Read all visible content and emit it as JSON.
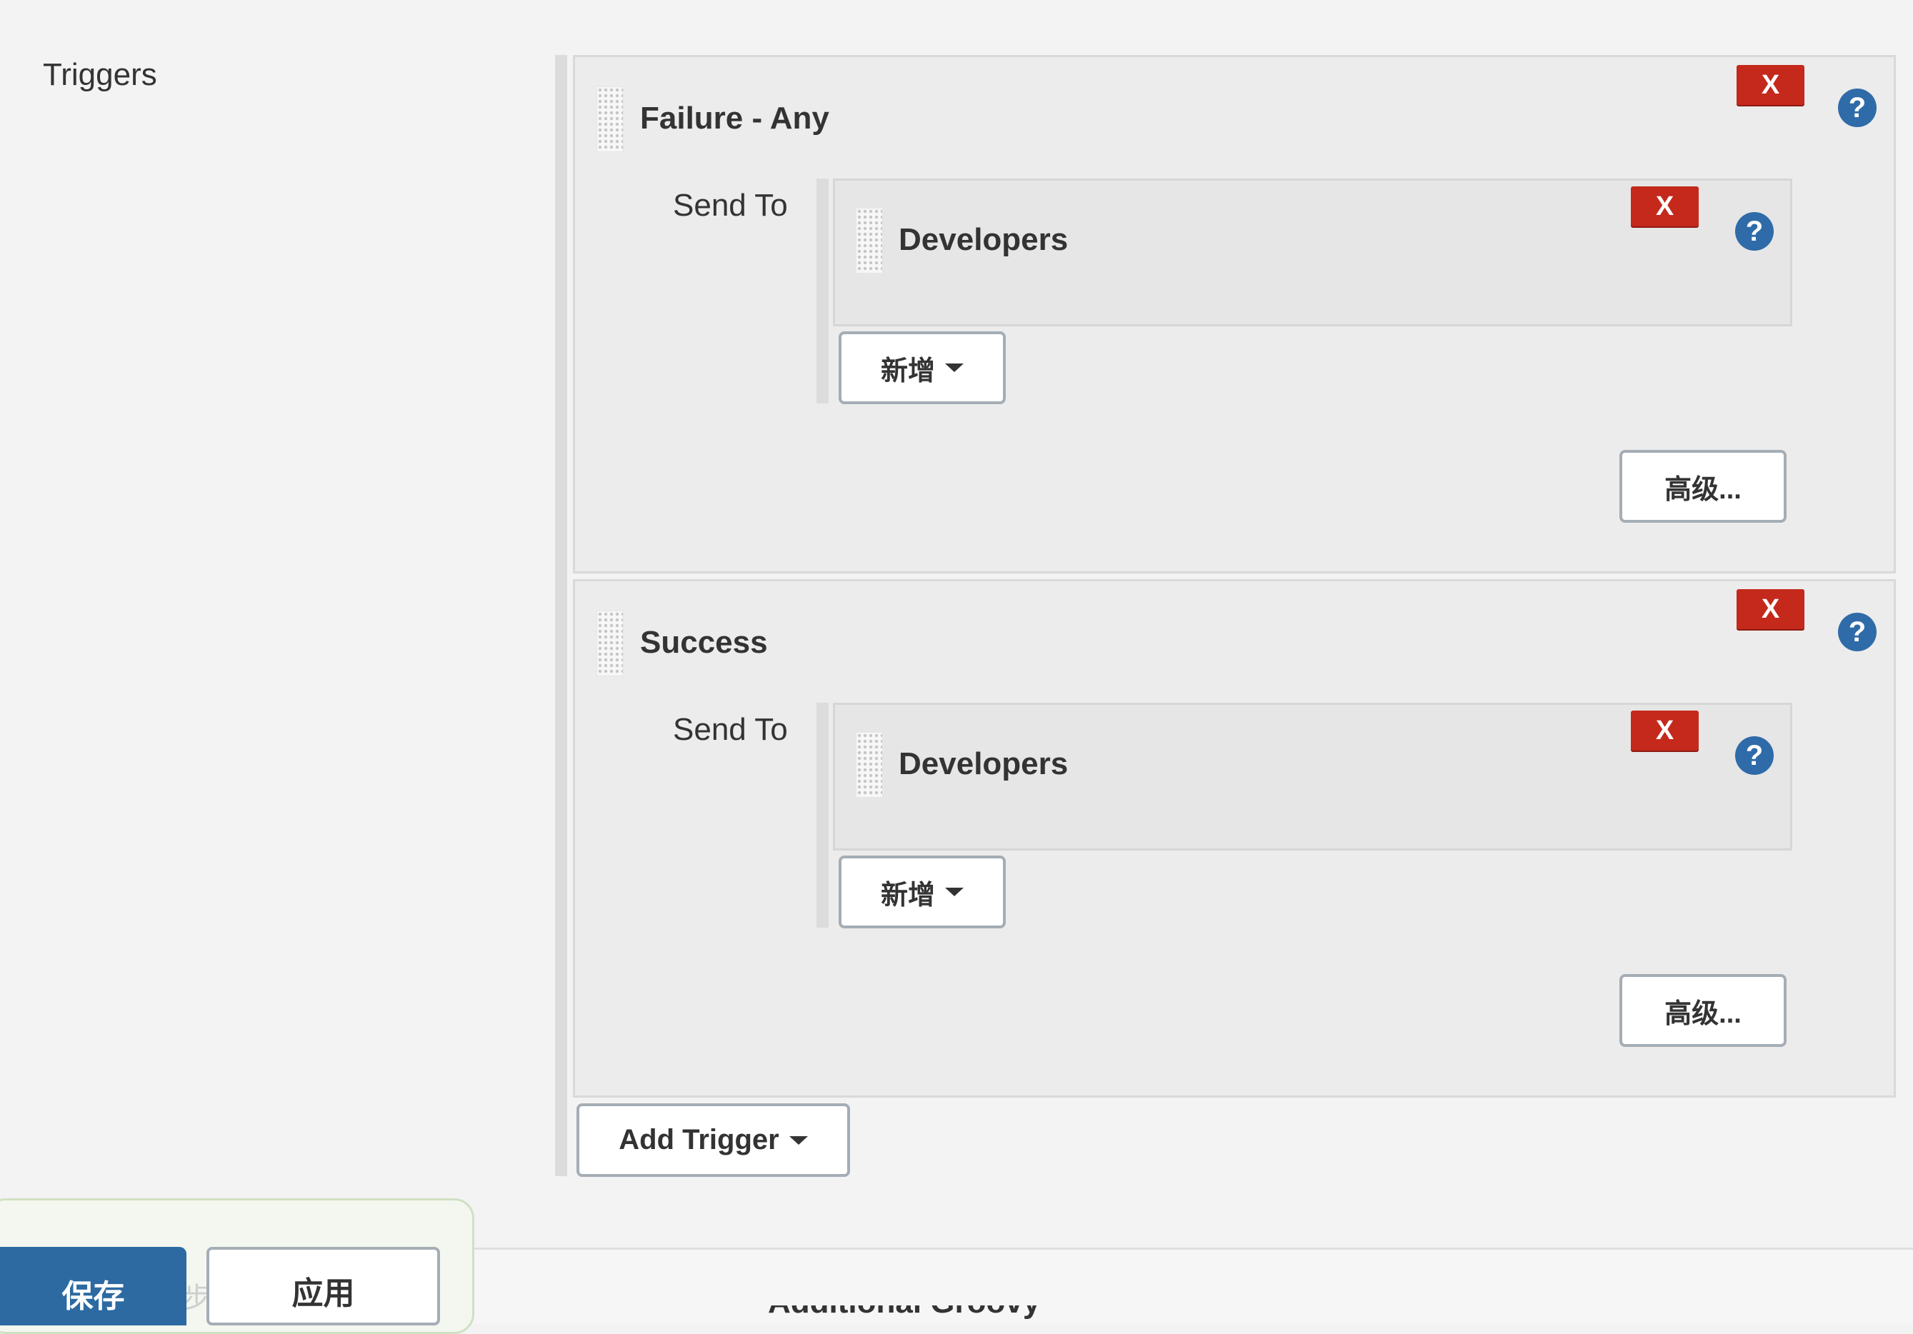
{
  "section": {
    "label": "Triggers"
  },
  "triggers": [
    {
      "title": "Failure - Any",
      "delete_label": "X",
      "help_label": "?",
      "send_to_label": "Send To",
      "recipients": [
        {
          "name": "Developers",
          "delete_label": "X",
          "help_label": "?"
        }
      ],
      "add_label": "新增",
      "advanced_label": "高级..."
    },
    {
      "title": "Success",
      "delete_label": "X",
      "help_label": "?",
      "send_to_label": "Send To",
      "recipients": [
        {
          "name": "Developers",
          "delete_label": "X",
          "help_label": "?"
        }
      ],
      "add_label": "新增",
      "advanced_label": "高级..."
    }
  ],
  "add_trigger_label": "Add Trigger",
  "footer": {
    "save_label": "保存",
    "apply_label": "应用",
    "faded_text": "步",
    "cutoff_text": "Additional Groovy"
  },
  "colors": {
    "delete": "#c4291c",
    "help": "#2f6ba8",
    "save": "#2c6aa1",
    "page_bg": "#f3f3f3",
    "block_bg": "#ececec"
  }
}
